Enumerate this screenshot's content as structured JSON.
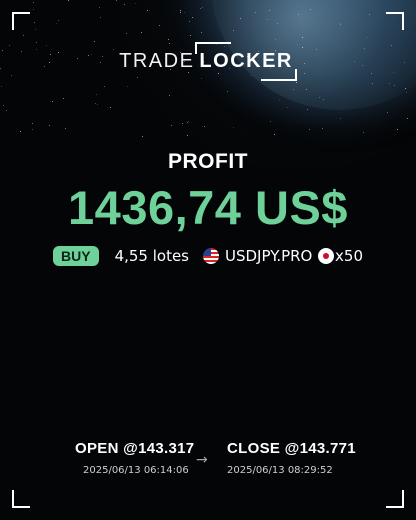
{
  "brand": {
    "part1": "TRADE",
    "part2": "LOCKER"
  },
  "profit": {
    "label": "PROFIT",
    "amount": "1436,74 US$"
  },
  "position": {
    "side": "BUY",
    "size": "4,55 lotes",
    "symbol": "USDJPY.PRO",
    "leverage": "x50",
    "flags": [
      "us-flag-icon",
      "jp-flag-icon"
    ]
  },
  "trade": {
    "open_label": "OPEN @143.317",
    "open_time": "2025/06/13 06:14:06",
    "arrow": "→",
    "close_label": "CLOSE @143.771",
    "close_time": "2025/06/13 08:29:52"
  },
  "colors": {
    "accent": "#6fd19a",
    "background": "#000000"
  }
}
